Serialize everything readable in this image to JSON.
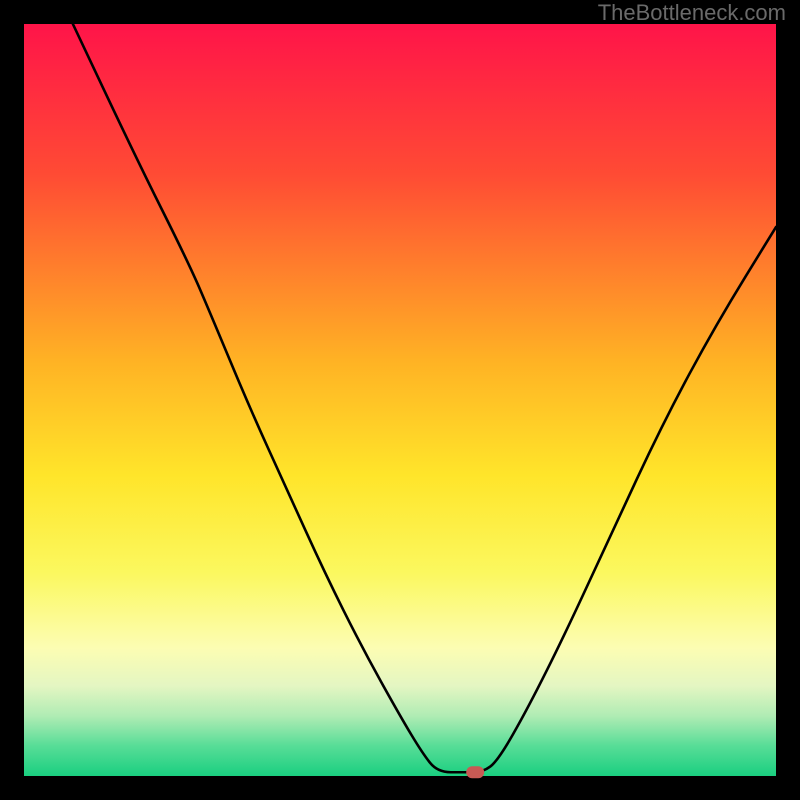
{
  "watermark": "TheBottleneck.com",
  "chart_data": {
    "type": "line",
    "title": "",
    "xlabel": "",
    "ylabel": "",
    "xlim": [
      0,
      100
    ],
    "ylim": [
      0,
      100
    ],
    "gradient_stops": [
      {
        "offset": 0,
        "color": "#ff1449"
      },
      {
        "offset": 20,
        "color": "#ff4b34"
      },
      {
        "offset": 45,
        "color": "#ffb324"
      },
      {
        "offset": 60,
        "color": "#ffe52a"
      },
      {
        "offset": 73,
        "color": "#fbf85f"
      },
      {
        "offset": 83,
        "color": "#fcfdb3"
      },
      {
        "offset": 88,
        "color": "#e4f6c2"
      },
      {
        "offset": 92,
        "color": "#b0ecb4"
      },
      {
        "offset": 96,
        "color": "#57dd97"
      },
      {
        "offset": 100,
        "color": "#1acf80"
      }
    ],
    "series": [
      {
        "name": "bottleneck-curve",
        "points": [
          {
            "x": 6.5,
            "y": 100
          },
          {
            "x": 15,
            "y": 82
          },
          {
            "x": 22,
            "y": 68
          },
          {
            "x": 25,
            "y": 61
          },
          {
            "x": 30,
            "y": 49
          },
          {
            "x": 35,
            "y": 38
          },
          {
            "x": 40,
            "y": 27
          },
          {
            "x": 45,
            "y": 17
          },
          {
            "x": 50,
            "y": 8
          },
          {
            "x": 53,
            "y": 3
          },
          {
            "x": 55,
            "y": 0.5
          },
          {
            "x": 58.5,
            "y": 0.5
          },
          {
            "x": 61,
            "y": 0.5
          },
          {
            "x": 63,
            "y": 2
          },
          {
            "x": 67,
            "y": 9
          },
          {
            "x": 72,
            "y": 19
          },
          {
            "x": 78,
            "y": 32
          },
          {
            "x": 85,
            "y": 47
          },
          {
            "x": 92,
            "y": 60
          },
          {
            "x": 100,
            "y": 73
          }
        ]
      }
    ],
    "marker": {
      "x": 60,
      "y": 0.5,
      "color": "#c85a54"
    }
  }
}
